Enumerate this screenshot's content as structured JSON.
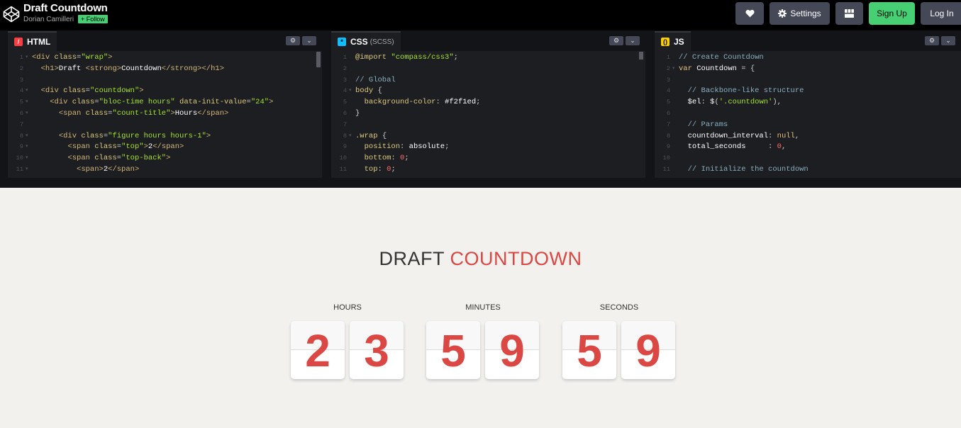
{
  "header": {
    "title": "Draft Countdown",
    "author": "Dorian Camilleri",
    "follow_label": "+ Follow",
    "settings_label": "Settings",
    "signup_label": "Sign Up",
    "login_label": "Log In"
  },
  "panes": {
    "html": {
      "label": "HTML",
      "icon_color": "#ff3c41"
    },
    "css": {
      "label": "CSS",
      "sub": "(SCSS)",
      "icon_color": "#0ebeff"
    },
    "js": {
      "label": "JS",
      "icon_color": "#fcd000"
    }
  },
  "preview": {
    "heading_main": "DRAFT",
    "heading_accent": "COUNTDOWN",
    "accent_color": "#db4844",
    "blocks": [
      {
        "title": "HOURS",
        "digits": [
          "2",
          "3"
        ]
      },
      {
        "title": "MINUTES",
        "digits": [
          "5",
          "9"
        ]
      },
      {
        "title": "SECONDS",
        "digits": [
          "5",
          "9"
        ]
      }
    ]
  }
}
